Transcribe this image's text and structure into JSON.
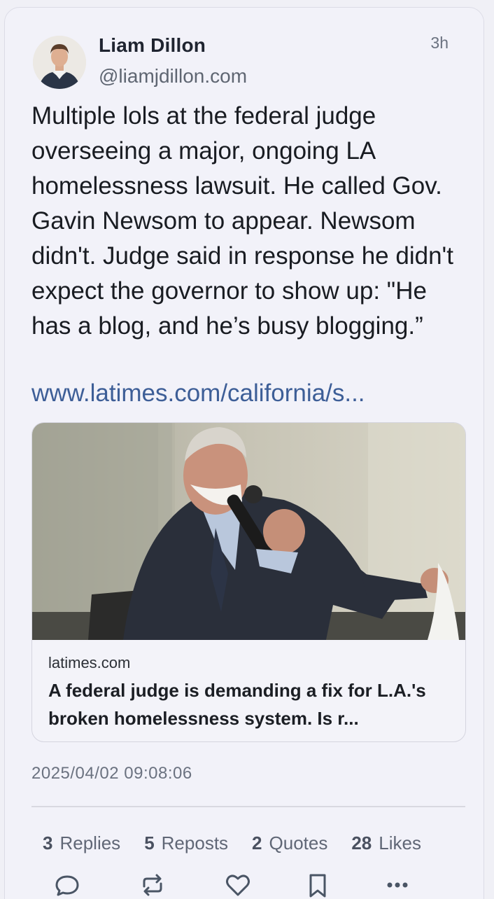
{
  "author": {
    "name": "Liam Dillon",
    "handle": "@liamjdillon.com",
    "time_ago": "3h"
  },
  "post": {
    "text": "Multiple lols at the federal judge overseeing a major, ongoing LA homelessness lawsuit. He called Gov. Gavin Newsom to appear. Newsom didn't. Judge said in response he didn't expect the governor to show up: \"He has a blog, and he’s busy blogging.”",
    "link": "www.latimes.com/california/s..."
  },
  "embed": {
    "domain": "latimes.com",
    "title": "A federal judge is demanding a fix for L.A.'s broken homelessness system. Is r..."
  },
  "datetime": "2025/04/02 09:08:06",
  "stats": [
    {
      "count": "3",
      "label": "Replies"
    },
    {
      "count": "5",
      "label": "Reposts"
    },
    {
      "count": "2",
      "label": "Quotes"
    },
    {
      "count": "28",
      "label": "Likes"
    }
  ],
  "actions": [
    "reply-icon",
    "repost-icon",
    "like-icon",
    "bookmark-icon",
    "more-icon"
  ],
  "colors": {
    "link": "#3d5e97",
    "text": "#191c22",
    "muted": "#6b7280",
    "background": "#f2f2f9"
  }
}
